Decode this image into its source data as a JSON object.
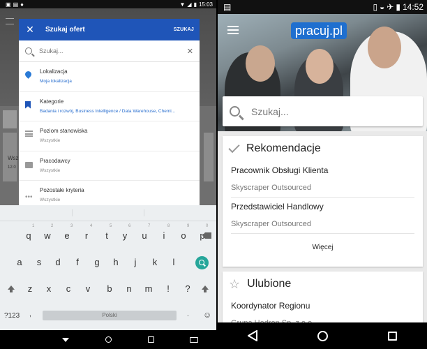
{
  "left": {
    "status": {
      "time": "15:03"
    },
    "background": {
      "partial_text_1": "Wsz",
      "partial_text_2": "12.0"
    },
    "dialog": {
      "title": "Szukaj ofert",
      "action": "SZUKAJ",
      "search_placeholder": "Szukaj...",
      "filters": [
        {
          "label": "Lokalizacja",
          "value": "Moja lokalizacja",
          "icon": "location-pin-icon"
        },
        {
          "label": "Kategorie",
          "value": "Badania i rozwój, Business Intelligence / Data Warehouse, Chemi...",
          "icon": "bookmark-icon"
        },
        {
          "label": "Poziom stanowiska",
          "value": "Wszystkie",
          "icon": "list-icon"
        },
        {
          "label": "Pracodawcy",
          "value": "Wszystkie",
          "icon": "briefcase-icon"
        },
        {
          "label": "Pozostałe kryteria",
          "value": "Wszystkie",
          "icon": "more-icon"
        }
      ]
    },
    "keyboard": {
      "row1": [
        "q",
        "w",
        "e",
        "r",
        "t",
        "y",
        "u",
        "i",
        "o",
        "p"
      ],
      "row1_hints": [
        "1",
        "2",
        "3",
        "4",
        "5",
        "6",
        "7",
        "8",
        "9",
        "0"
      ],
      "row2": [
        "a",
        "s",
        "d",
        "f",
        "g",
        "h",
        "j",
        "k",
        "l"
      ],
      "row3": [
        "z",
        "x",
        "c",
        "v",
        "b",
        "n",
        "m",
        "!",
        "?"
      ],
      "symbols_key": "?123",
      "comma_key": ",",
      "space_label": "Polski",
      "period_key": ".",
      "emoji_key": "☺"
    }
  },
  "right": {
    "status": {
      "time": "14:52"
    },
    "logo": "pracuj.pl",
    "search_placeholder": "Szukaj...",
    "recommendations": {
      "title": "Rekomendacje",
      "jobs": [
        {
          "title": "Pracownik Obsługi Klienta",
          "company": "Skyscraper Outsourced"
        },
        {
          "title": "Przedstawiciel Handlowy",
          "company": "Skyscraper Outsourced"
        }
      ],
      "more_label": "Więcej"
    },
    "favorites": {
      "title": "Ulubione",
      "jobs": [
        {
          "title": "Koordynator Regionu",
          "company": "Grupa Hedron Sp. z o.o."
        }
      ]
    }
  }
}
